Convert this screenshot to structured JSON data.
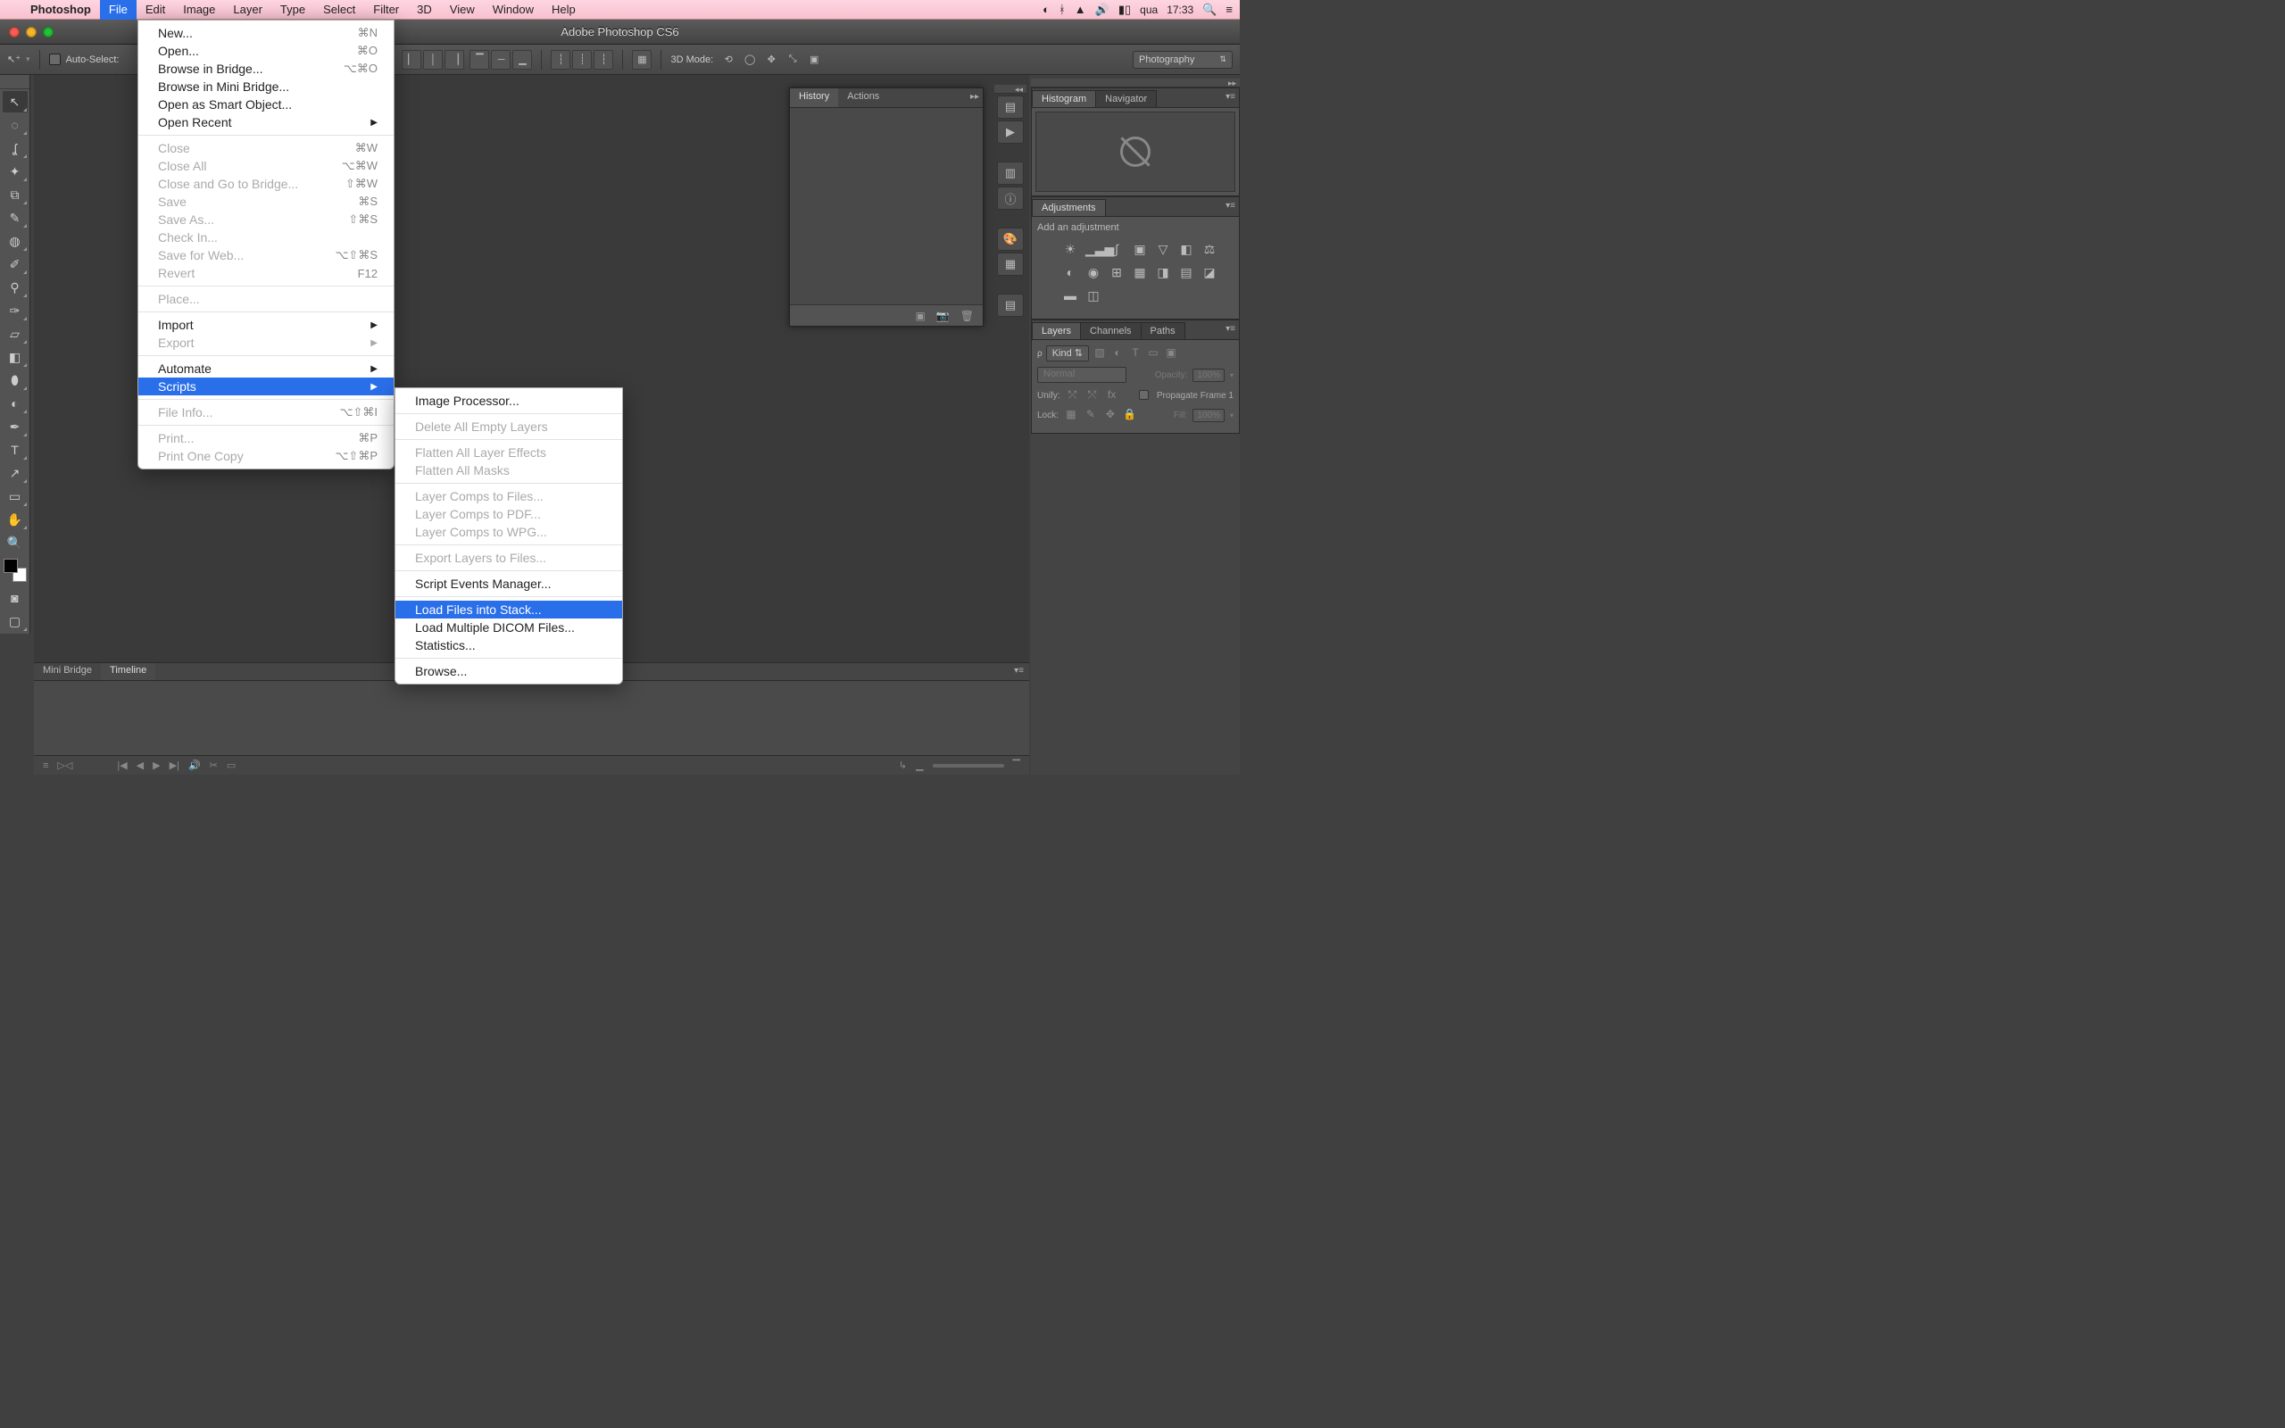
{
  "menubar": {
    "app": "Photoshop",
    "items": [
      "File",
      "Edit",
      "Image",
      "Layer",
      "Type",
      "Select",
      "Filter",
      "3D",
      "View",
      "Window",
      "Help"
    ],
    "active": "File",
    "right": {
      "day": "qua",
      "time": "17:33"
    }
  },
  "window": {
    "title": "Adobe Photoshop CS6"
  },
  "optionsbar": {
    "autoselect": "Auto-Select:",
    "mode3d": "3D Mode:",
    "workspace": "Photography"
  },
  "file_menu": [
    {
      "label": "New...",
      "sc": "⌘N"
    },
    {
      "label": "Open...",
      "sc": "⌘O"
    },
    {
      "label": "Browse in Bridge...",
      "sc": "⌥⌘O"
    },
    {
      "label": "Browse in Mini Bridge..."
    },
    {
      "label": "Open as Smart Object..."
    },
    {
      "label": "Open Recent",
      "sub": true
    },
    {
      "sep": true
    },
    {
      "label": "Close",
      "sc": "⌘W",
      "dis": true
    },
    {
      "label": "Close All",
      "sc": "⌥⌘W",
      "dis": true
    },
    {
      "label": "Close and Go to Bridge...",
      "sc": "⇧⌘W",
      "dis": true
    },
    {
      "label": "Save",
      "sc": "⌘S",
      "dis": true
    },
    {
      "label": "Save As...",
      "sc": "⇧⌘S",
      "dis": true
    },
    {
      "label": "Check In...",
      "dis": true
    },
    {
      "label": "Save for Web...",
      "sc": "⌥⇧⌘S",
      "dis": true
    },
    {
      "label": "Revert",
      "sc": "F12",
      "dis": true
    },
    {
      "sep": true
    },
    {
      "label": "Place...",
      "dis": true
    },
    {
      "sep": true
    },
    {
      "label": "Import",
      "sub": true
    },
    {
      "label": "Export",
      "sub": true,
      "dis": true
    },
    {
      "sep": true
    },
    {
      "label": "Automate",
      "sub": true
    },
    {
      "label": "Scripts",
      "sub": true,
      "hl": true
    },
    {
      "sep": true
    },
    {
      "label": "File Info...",
      "sc": "⌥⇧⌘I",
      "dis": true
    },
    {
      "sep": true
    },
    {
      "label": "Print...",
      "sc": "⌘P",
      "dis": true
    },
    {
      "label": "Print One Copy",
      "sc": "⌥⇧⌘P",
      "dis": true
    }
  ],
  "scripts_menu": [
    {
      "label": "Image Processor..."
    },
    {
      "sep": true
    },
    {
      "label": "Delete All Empty Layers",
      "dis": true
    },
    {
      "sep": true
    },
    {
      "label": "Flatten All Layer Effects",
      "dis": true
    },
    {
      "label": "Flatten All Masks",
      "dis": true
    },
    {
      "sep": true
    },
    {
      "label": "Layer Comps to Files...",
      "dis": true
    },
    {
      "label": "Layer Comps to PDF...",
      "dis": true
    },
    {
      "label": "Layer Comps to WPG...",
      "dis": true
    },
    {
      "sep": true
    },
    {
      "label": "Export Layers to Files...",
      "dis": true
    },
    {
      "sep": true
    },
    {
      "label": "Script Events Manager..."
    },
    {
      "sep": true
    },
    {
      "label": "Load Files into Stack...",
      "hl": true
    },
    {
      "label": "Load Multiple DICOM Files..."
    },
    {
      "label": "Statistics..."
    },
    {
      "sep": true
    },
    {
      "label": "Browse..."
    }
  ],
  "panels": {
    "history": {
      "tabs": [
        "History",
        "Actions"
      ]
    },
    "histogram": {
      "tabs": [
        "Histogram",
        "Navigator"
      ]
    },
    "adjustments": {
      "title": "Adjustments",
      "hint": "Add an adjustment"
    },
    "layers": {
      "tabs": [
        "Layers",
        "Channels",
        "Paths"
      ],
      "kind": "Kind",
      "blend": "Normal",
      "opacity_label": "Opacity:",
      "opacity": "100%",
      "unify": "Unify:",
      "propagate": "Propagate Frame 1",
      "lock": "Lock:",
      "fill_label": "Fill:",
      "fill": "100%"
    }
  },
  "bottom": {
    "tabs": [
      "Mini Bridge",
      "Timeline"
    ]
  }
}
